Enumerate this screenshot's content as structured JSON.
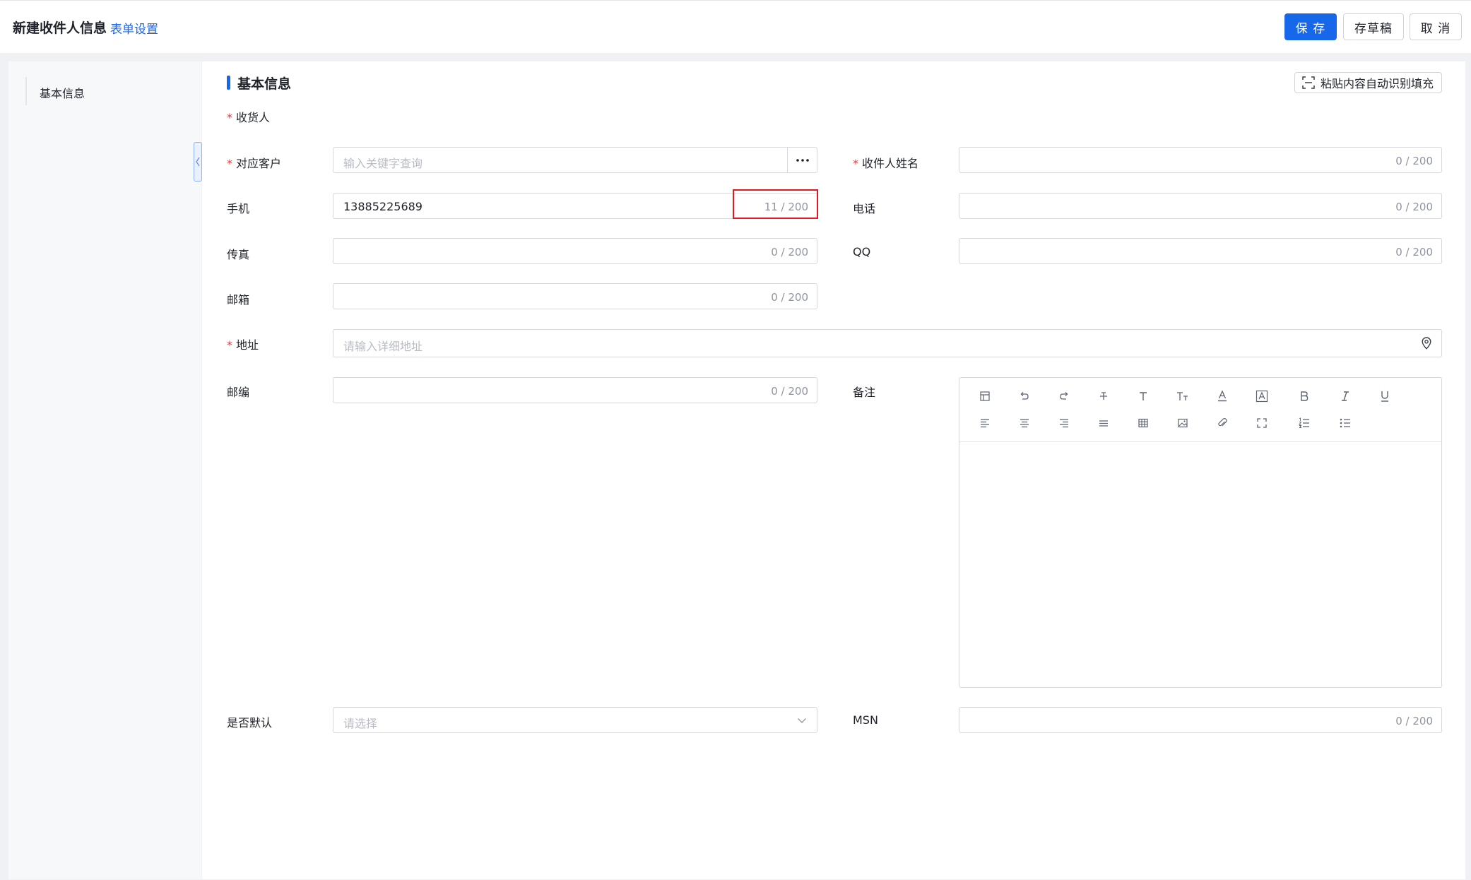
{
  "header": {
    "title": "新建收件人信息",
    "settings_link": "表单设置",
    "save_label": "保 存",
    "draft_label": "存草稿",
    "cancel_label": "取 消"
  },
  "sidebar": {
    "items": [
      {
        "label": "基本信息"
      }
    ]
  },
  "section": {
    "title": "基本信息",
    "autofill_label": "粘贴内容自动识别填充"
  },
  "form": {
    "receiver_group_label": "收货人",
    "customer": {
      "label": "对应客户",
      "placeholder": "输入关键字查询"
    },
    "receiver_name": {
      "label": "收件人姓名",
      "count": "0 / 200"
    },
    "mobile": {
      "label": "手机",
      "value": "13885225689",
      "count": "11 / 200"
    },
    "phone": {
      "label": "电话",
      "count": "0 / 200"
    },
    "fax": {
      "label": "传真",
      "count": "0 / 200"
    },
    "qq": {
      "label": "QQ",
      "count": "0 / 200"
    },
    "email": {
      "label": "邮箱",
      "count": "0 / 200"
    },
    "address": {
      "label": "地址",
      "placeholder": "请输入详细地址"
    },
    "zipcode": {
      "label": "邮编",
      "count": "0 / 200"
    },
    "remark": {
      "label": "备注"
    },
    "is_default": {
      "label": "是否默认",
      "placeholder": "请选择"
    },
    "msn": {
      "label": "MSN",
      "count": "0 / 200"
    }
  },
  "colors": {
    "primary": "#1767ea",
    "required": "#e5343a",
    "highlight": "#e5161d"
  }
}
